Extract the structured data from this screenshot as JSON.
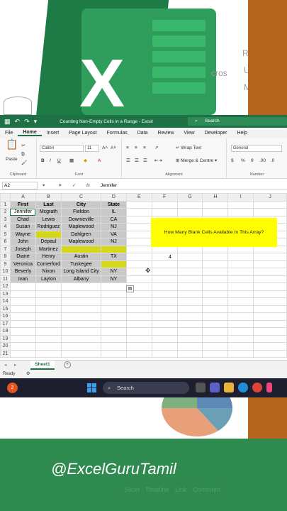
{
  "banner": {
    "ghost_texts": [
      "R",
      "cros",
      "U",
      "M"
    ]
  },
  "titlebar": {
    "file_title": "Counting Non-Empty Cells in a Range",
    "app": "Excel",
    "search_placeholder": "Search"
  },
  "menu": {
    "tabs": [
      "File",
      "Home",
      "Insert",
      "Page Layout",
      "Formulas",
      "Data",
      "Review",
      "View",
      "Developer",
      "Help"
    ],
    "active": "Home"
  },
  "ribbon": {
    "paste_label": "Paste",
    "clipboard_label": "Clipboard",
    "font_name": "Calibri",
    "font_size": "11",
    "font_label": "Font",
    "bold": "B",
    "italic": "I",
    "underline": "U",
    "wrap_text": "Wrap Text",
    "merge_center": "Merge & Centre",
    "alignment_label": "Alignment",
    "number_format": "General",
    "number_label": "Number",
    "number_buttons": [
      "%",
      "9",
      ".00",
      ".0"
    ]
  },
  "formula_bar": {
    "name_box": "A2",
    "fx": "fx",
    "content": "Jennifer"
  },
  "sheet": {
    "columns": [
      "A",
      "B",
      "C",
      "D",
      "E",
      "F",
      "G",
      "H",
      "I",
      "J"
    ],
    "headers": [
      "First",
      "Last",
      "City",
      "State"
    ],
    "rows": [
      [
        "Jennifer",
        "Mcgrath",
        "Fieldon",
        "IL"
      ],
      [
        "Chad",
        "Lewis",
        "Downieville",
        "CA"
      ],
      [
        "Susan",
        "Rodriguez",
        "Maplewood",
        "NJ"
      ],
      [
        "Wayne",
        "",
        "Dahlgren",
        "VA"
      ],
      [
        "John",
        "Depaul",
        "Maplewood",
        "NJ"
      ],
      [
        "Joseph",
        "Martinez",
        "",
        ""
      ],
      [
        "Diane",
        "Henry",
        "Austin",
        "TX"
      ],
      [
        "Veronica",
        "Comerford",
        "Tuskegee",
        ""
      ],
      [
        "Beverly",
        "Nixon",
        "Long Island City",
        "NY"
      ],
      [
        "Ivan",
        "Layton",
        "Albany",
        "NY"
      ]
    ],
    "row_numbers": [
      "1",
      "2",
      "3",
      "4",
      "5",
      "6",
      "7",
      "8",
      "9",
      "10",
      "11",
      "12",
      "13",
      "14",
      "15",
      "16",
      "17",
      "18",
      "19",
      "20",
      "21"
    ],
    "question": "How Many Blank Cells Available In This Array?",
    "answer": "4"
  },
  "tabs": {
    "sheet_name": "Sheet1",
    "status": "Ready"
  },
  "taskbar": {
    "badge": "2",
    "search": "Search"
  },
  "footer": {
    "handle": "@ExcelGuruTamil",
    "faint_labels": [
      "Slicer",
      "Timeline",
      "Link",
      "Comment"
    ]
  },
  "colors": {
    "excel_green": "#1e7145",
    "highlight_yellow": "#ffff00",
    "blank_cell_yellow": "#d7d71a",
    "data_gray": "#c9c9c9",
    "accent_orange": "#b5651d"
  }
}
